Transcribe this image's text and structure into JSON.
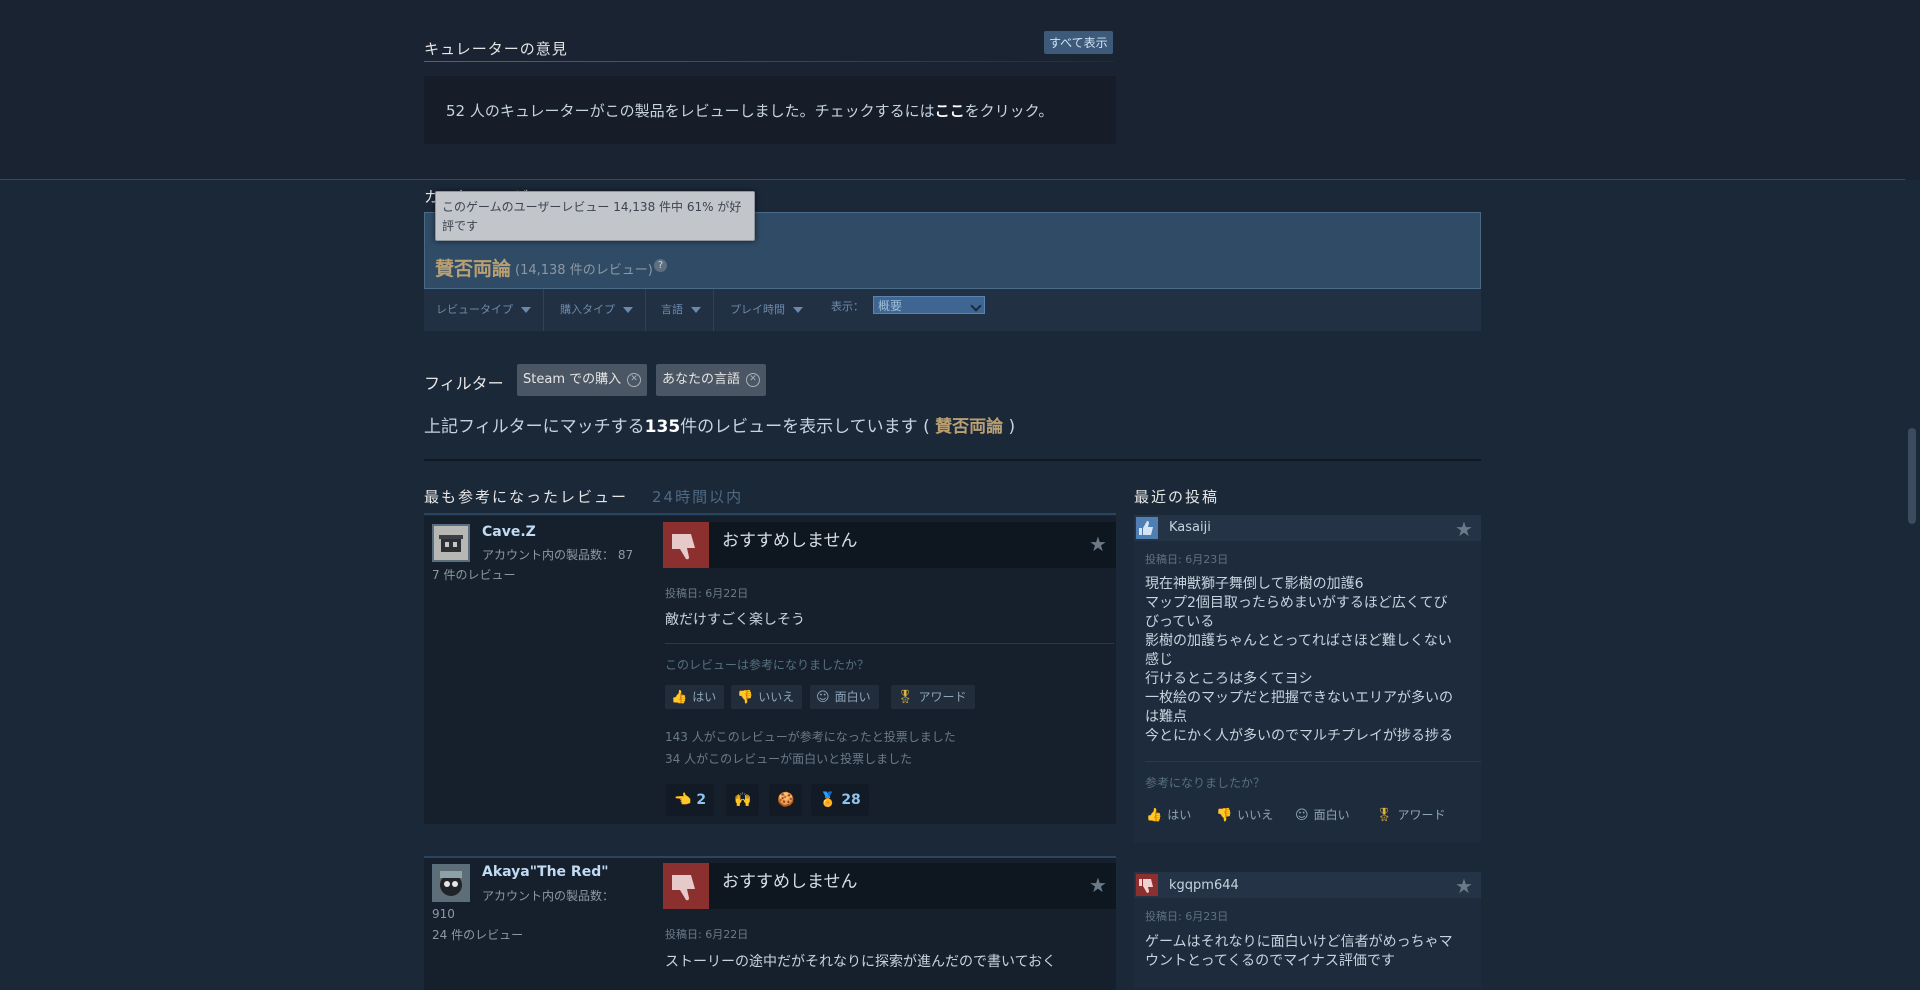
{
  "curators": {
    "title": "キュレーターの意見",
    "see_all": "すべて表示",
    "count": "52",
    "text_before": " 人のキュレーターがこの製品をレビューしました。チェックするには",
    "link": "ここ",
    "text_after": "をクリック。"
  },
  "review_summary": {
    "title": "カスタマーレビュー",
    "tooltip": "このゲームのユーザーレビュー 14,138 件中 61% が好評です",
    "rating": "賛否両論",
    "count_text": "(14,138 件のレビュー)",
    "help": "?"
  },
  "filter_bar": {
    "review_type": "レビュータイプ",
    "purchase_type": "購入タイプ",
    "language": "言語",
    "playtime": "プレイ時間",
    "show_label": "表示：",
    "show_value": "概要"
  },
  "filters": {
    "label": "フィルター",
    "chips": [
      "Steam での購入",
      "あなたの言語"
    ],
    "match_prefix": "上記フィルターにマッチする",
    "match_count": "135",
    "match_middle": "件のレビューを表示しています ( ",
    "match_rating": "賛否両論",
    "match_suffix": " )"
  },
  "most_helpful": {
    "title": "最も参考になったレビュー",
    "period": "24時間以内"
  },
  "reviews": [
    {
      "author": "Cave.Z",
      "products": "アカウント内の製品数： 87",
      "review_count": "7 件のレビュー",
      "verdict": "おすすめしません",
      "posted": "投稿日: 6月22日",
      "body": "敵だけすごく楽しそう",
      "question": "このレビューは参考になりましたか？",
      "btn_yes": "はい",
      "btn_no": "いいえ",
      "btn_funny": "面白い",
      "btn_award": "アワード",
      "stat_helpful": "143 人がこのレビューが参考になったと投票しました",
      "stat_funny": "34 人がこのレビューが面白いと投票しました",
      "award_1": "2",
      "award_4": "28"
    },
    {
      "author": "Akaya\"The Red\"",
      "products_label": "アカウント内の製品数：",
      "products_value": "910",
      "review_count": "24 件のレビュー",
      "verdict": "おすすめしません",
      "posted": "投稿日: 6月22日",
      "body": "ストーリーの途中だがそれなりに探索が進んだので書いておく"
    }
  ],
  "recent": {
    "title": "最近の投稿",
    "posts": [
      {
        "user": "Kasaiji",
        "date": "投稿日: 6月23日",
        "lines": [
          "現在神獣獅子舞倒して影樹の加護6",
          "マップ2個目取ったらめまいがするほど広くてび",
          "びっている",
          "影樹の加護ちゃんととってればさほど難しくない",
          "感じ",
          "行けるところは多くてヨシ",
          "一枚絵のマップだと把握できないエリアが多いの",
          "は難点",
          "今とにかく人が多いのでマルチプレイが捗る捗る"
        ],
        "question": "参考になりましたか？",
        "btn_yes": "はい",
        "btn_no": "いいえ",
        "btn_funny": "面白い",
        "btn_award": "アワード"
      },
      {
        "user": "kgqpm644",
        "date": "投稿日: 6月23日",
        "lines": [
          "ゲームはそれなりに面白いけど信者がめっちゃマ",
          "ウントとってくるのでマイナス評価です"
        ]
      }
    ]
  },
  "colors": {
    "background": "#1b2838",
    "mixed": "#b9a074",
    "negative": "#8c2f2f",
    "link_blue": "#c1dbf4"
  }
}
